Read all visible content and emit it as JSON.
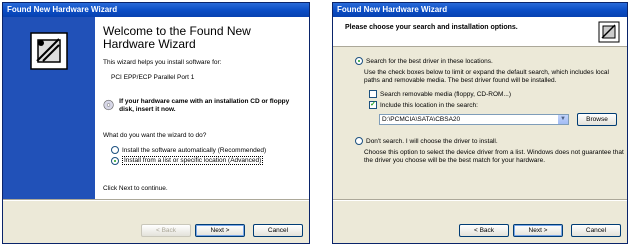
{
  "window1": {
    "title": "Found New Hardware Wizard",
    "icon_name": "hardware-wizard-icon",
    "heading": "Welcome to the Found New Hardware Wizard",
    "intro": "This wizard helps you install software for:",
    "device": "PCI EPP/ECP Parallel Port 1",
    "cd_icon": "cd-icon",
    "cd_notice": "If your hardware came with an installation CD or floppy disk, insert it now.",
    "question": "What do you want the wizard to do?",
    "option_auto": "Install the software automatically (Recommended)",
    "option_list": "Install from a list or specific location (Advanced)",
    "continue": "Click Next to continue.",
    "back": "< Back",
    "next": "Next >",
    "cancel": "Cancel"
  },
  "window2": {
    "title": "Found New Hardware Wizard",
    "header": "Please choose your search and installation options.",
    "icon_name": "hardware-icon",
    "option_search": "Search for the best driver in these locations.",
    "search_desc": "Use the check boxes below to limit or expand the default search, which includes local paths and removable media. The best driver found will be installed.",
    "chk_removable": "Search removable media (floppy, CD-ROM...)",
    "chk_location": "Include this location in the search:",
    "path": "D:\\PCMCIA\\SATA\\CBSA20",
    "browse": "Browse",
    "option_dont": "Don't search. I will choose the driver to install.",
    "dont_desc": "Choose this option to select the device driver from a list. Windows does not guarantee that the driver you choose will be the best match for your hardware.",
    "back": "< Back",
    "next": "Next >",
    "cancel": "Cancel"
  }
}
